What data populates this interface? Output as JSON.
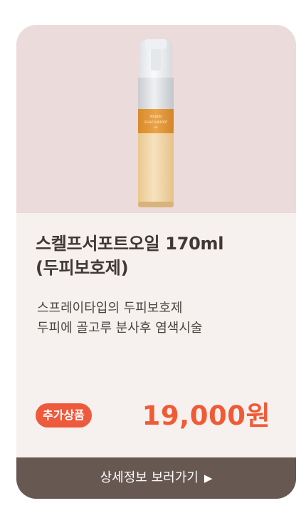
{
  "product": {
    "name_line1": "스켈프서포트오일 170ml",
    "name_line2": "(두피보호제)",
    "description_line1": "스프레이타입의 두피보호제",
    "description_line2": "두피에 골고루 분사후 염색시술",
    "badge": "추가상품",
    "price": "19,000원",
    "bottle_label_brand": "MILBON",
    "bottle_label_product": "SCALP SUPPORT",
    "bottle_label_sub": "OIL"
  },
  "cta": {
    "label": "상세정보 보러가기",
    "arrow": "▶"
  },
  "colors": {
    "card_bg": "#f6f1ee",
    "hero_bg": "#ecdbdb",
    "accent": "#f05a36",
    "badge_bg": "#ee5a3c",
    "button_bg": "#675852"
  }
}
